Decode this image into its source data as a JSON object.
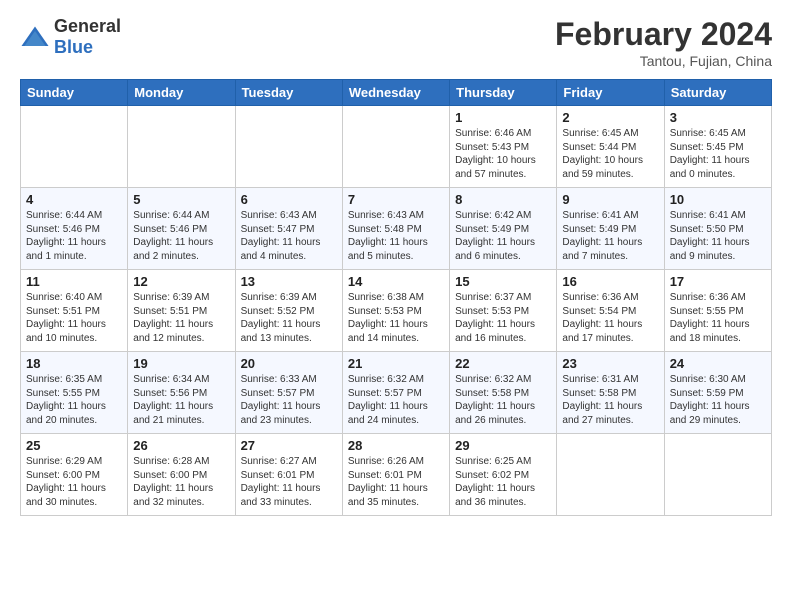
{
  "header": {
    "logo_general": "General",
    "logo_blue": "Blue",
    "month_year": "February 2024",
    "location": "Tantou, Fujian, China"
  },
  "days_of_week": [
    "Sunday",
    "Monday",
    "Tuesday",
    "Wednesday",
    "Thursday",
    "Friday",
    "Saturday"
  ],
  "weeks": [
    [
      {
        "day": "",
        "info": ""
      },
      {
        "day": "",
        "info": ""
      },
      {
        "day": "",
        "info": ""
      },
      {
        "day": "",
        "info": ""
      },
      {
        "day": "1",
        "info": "Sunrise: 6:46 AM\nSunset: 5:43 PM\nDaylight: 10 hours and 57 minutes."
      },
      {
        "day": "2",
        "info": "Sunrise: 6:45 AM\nSunset: 5:44 PM\nDaylight: 10 hours and 59 minutes."
      },
      {
        "day": "3",
        "info": "Sunrise: 6:45 AM\nSunset: 5:45 PM\nDaylight: 11 hours and 0 minutes."
      }
    ],
    [
      {
        "day": "4",
        "info": "Sunrise: 6:44 AM\nSunset: 5:46 PM\nDaylight: 11 hours and 1 minute."
      },
      {
        "day": "5",
        "info": "Sunrise: 6:44 AM\nSunset: 5:46 PM\nDaylight: 11 hours and 2 minutes."
      },
      {
        "day": "6",
        "info": "Sunrise: 6:43 AM\nSunset: 5:47 PM\nDaylight: 11 hours and 4 minutes."
      },
      {
        "day": "7",
        "info": "Sunrise: 6:43 AM\nSunset: 5:48 PM\nDaylight: 11 hours and 5 minutes."
      },
      {
        "day": "8",
        "info": "Sunrise: 6:42 AM\nSunset: 5:49 PM\nDaylight: 11 hours and 6 minutes."
      },
      {
        "day": "9",
        "info": "Sunrise: 6:41 AM\nSunset: 5:49 PM\nDaylight: 11 hours and 7 minutes."
      },
      {
        "day": "10",
        "info": "Sunrise: 6:41 AM\nSunset: 5:50 PM\nDaylight: 11 hours and 9 minutes."
      }
    ],
    [
      {
        "day": "11",
        "info": "Sunrise: 6:40 AM\nSunset: 5:51 PM\nDaylight: 11 hours and 10 minutes."
      },
      {
        "day": "12",
        "info": "Sunrise: 6:39 AM\nSunset: 5:51 PM\nDaylight: 11 hours and 12 minutes."
      },
      {
        "day": "13",
        "info": "Sunrise: 6:39 AM\nSunset: 5:52 PM\nDaylight: 11 hours and 13 minutes."
      },
      {
        "day": "14",
        "info": "Sunrise: 6:38 AM\nSunset: 5:53 PM\nDaylight: 11 hours and 14 minutes."
      },
      {
        "day": "15",
        "info": "Sunrise: 6:37 AM\nSunset: 5:53 PM\nDaylight: 11 hours and 16 minutes."
      },
      {
        "day": "16",
        "info": "Sunrise: 6:36 AM\nSunset: 5:54 PM\nDaylight: 11 hours and 17 minutes."
      },
      {
        "day": "17",
        "info": "Sunrise: 6:36 AM\nSunset: 5:55 PM\nDaylight: 11 hours and 18 minutes."
      }
    ],
    [
      {
        "day": "18",
        "info": "Sunrise: 6:35 AM\nSunset: 5:55 PM\nDaylight: 11 hours and 20 minutes."
      },
      {
        "day": "19",
        "info": "Sunrise: 6:34 AM\nSunset: 5:56 PM\nDaylight: 11 hours and 21 minutes."
      },
      {
        "day": "20",
        "info": "Sunrise: 6:33 AM\nSunset: 5:57 PM\nDaylight: 11 hours and 23 minutes."
      },
      {
        "day": "21",
        "info": "Sunrise: 6:32 AM\nSunset: 5:57 PM\nDaylight: 11 hours and 24 minutes."
      },
      {
        "day": "22",
        "info": "Sunrise: 6:32 AM\nSunset: 5:58 PM\nDaylight: 11 hours and 26 minutes."
      },
      {
        "day": "23",
        "info": "Sunrise: 6:31 AM\nSunset: 5:58 PM\nDaylight: 11 hours and 27 minutes."
      },
      {
        "day": "24",
        "info": "Sunrise: 6:30 AM\nSunset: 5:59 PM\nDaylight: 11 hours and 29 minutes."
      }
    ],
    [
      {
        "day": "25",
        "info": "Sunrise: 6:29 AM\nSunset: 6:00 PM\nDaylight: 11 hours and 30 minutes."
      },
      {
        "day": "26",
        "info": "Sunrise: 6:28 AM\nSunset: 6:00 PM\nDaylight: 11 hours and 32 minutes."
      },
      {
        "day": "27",
        "info": "Sunrise: 6:27 AM\nSunset: 6:01 PM\nDaylight: 11 hours and 33 minutes."
      },
      {
        "day": "28",
        "info": "Sunrise: 6:26 AM\nSunset: 6:01 PM\nDaylight: 11 hours and 35 minutes."
      },
      {
        "day": "29",
        "info": "Sunrise: 6:25 AM\nSunset: 6:02 PM\nDaylight: 11 hours and 36 minutes."
      },
      {
        "day": "",
        "info": ""
      },
      {
        "day": "",
        "info": ""
      }
    ]
  ]
}
